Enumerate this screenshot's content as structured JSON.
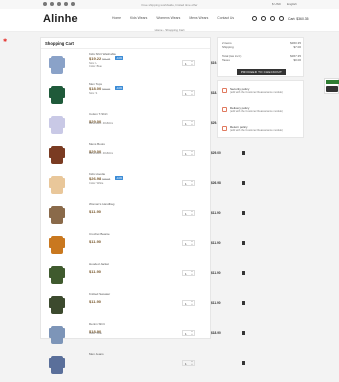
{
  "topbar": {
    "promo": "Free shipping worldwide, limited time offer",
    "currency": "$ USD",
    "language": "English"
  },
  "header": {
    "logo": "Alinhe",
    "nav": [
      "Home",
      "Kids Wears",
      "Womens Wears",
      "Mens Wears",
      "Contact Us"
    ],
    "cart_label": "Cart: $360.35"
  },
  "breadcrumb": {
    "home": "Home",
    "current": "Shopping Cart"
  },
  "cart": {
    "title": "Shopping Cart",
    "items": [
      {
        "name": "Kids Shirt Washable",
        "price": "$19.22",
        "old": "$21.35",
        "badge": "-10%",
        "attr": "Size: L",
        "attr2": "Color: Blue",
        "qty": "1",
        "total": "$19.22",
        "color": "#8aa2c8"
      },
      {
        "name": "Men Tops",
        "price": "$18.00",
        "old": "$20.00",
        "badge": "-10%",
        "attr": "Size: S",
        "attr2": "",
        "qty": "1",
        "total": "$18.00",
        "color": "#1f5a3a"
      },
      {
        "name": "Cotton T-Shirt",
        "price": "$29.00",
        "old": "",
        "badge": "",
        "attr": "Dimension: 40x60cm",
        "attr2": "",
        "qty": "1",
        "total": "$29.00",
        "color": "#c9c9e6"
      },
      {
        "name": "Mens Boots",
        "price": "$29.00",
        "old": "",
        "badge": "",
        "attr": "Dimension: 40x60cm",
        "attr2": "",
        "qty": "1",
        "total": "$29.00",
        "color": "#7a3b22"
      },
      {
        "name": "Kids Hoodie",
        "price": "$26.98",
        "old": "$28.98",
        "badge": "-10%",
        "attr": "Color: White",
        "attr2": "",
        "qty": "1",
        "total": "$26.98",
        "color": "#e9c79a"
      },
      {
        "name": "Woman's Handbag",
        "price": "$11.90",
        "old": "",
        "badge": "",
        "attr": "",
        "attr2": "",
        "qty": "1",
        "total": "$11.90",
        "color": "#8a6a4a"
      },
      {
        "name": "Crochet Beanie",
        "price": "$11.90",
        "old": "",
        "badge": "",
        "attr": "",
        "attr2": "",
        "qty": "1",
        "total": "$11.90",
        "color": "#c9781f"
      },
      {
        "name": "Hooded Jacket",
        "price": "$11.90",
        "old": "",
        "badge": "",
        "attr": "",
        "attr2": "",
        "qty": "1",
        "total": "$11.90",
        "color": "#3f5a2e"
      },
      {
        "name": "Knitted Sweater",
        "price": "$11.90",
        "old": "",
        "badge": "",
        "attr": "",
        "attr2": "",
        "qty": "1",
        "total": "$11.90",
        "color": "#3c4a2e"
      },
      {
        "name": "Denim Shirt",
        "price": "$18.90",
        "old": "",
        "badge": "",
        "attr": "Color: Blue",
        "attr2": "",
        "qty": "1",
        "total": "$18.90",
        "color": "#7d95b8"
      },
      {
        "name": "Men Jeans",
        "price": "",
        "old": "",
        "badge": "",
        "attr": "",
        "attr2": "",
        "qty": "1",
        "total": "",
        "color": "#5a6f9a"
      }
    ]
  },
  "summary": {
    "rows": [
      {
        "label": "2 items",
        "value": "$360.35"
      },
      {
        "label": "Shipping",
        "value": "$7.00"
      },
      {
        "label": "Total (tax incl.)",
        "value": "$367.35"
      },
      {
        "label": "Taxes",
        "value": "$0.00"
      }
    ],
    "checkout": "PROCEED TO CHECKOUT"
  },
  "policies": [
    {
      "title": "Security policy",
      "desc": "(edit with the Customer Reassurance module)"
    },
    {
      "title": "Delivery policy",
      "desc": "(edit with the Customer Reassurance module)"
    },
    {
      "title": "Return policy",
      "desc": "(edit with the Customer Reassurance module)"
    }
  ]
}
